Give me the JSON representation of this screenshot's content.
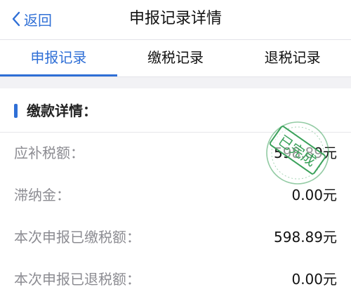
{
  "nav": {
    "back_label": "返回",
    "title": "申报记录详情"
  },
  "tabs": [
    {
      "label": "申报记录",
      "active": true
    },
    {
      "label": "缴税记录",
      "active": false
    },
    {
      "label": "退税记录",
      "active": false
    }
  ],
  "section": {
    "title": "缴款详情："
  },
  "rows": [
    {
      "label": "应补税额：",
      "value": "598.89元"
    },
    {
      "label": "滞纳金：",
      "value": "0.00元"
    },
    {
      "label": "本次申报已缴税额：",
      "value": "598.89元"
    },
    {
      "label": "本次申报已退税额：",
      "value": "0.00元"
    }
  ],
  "stamp": {
    "text": "已完成",
    "color": "#3aa15a"
  },
  "colors": {
    "accent": "#2f6fd6",
    "label": "#8c8c92"
  },
  "icons": {
    "back": "chevron-left-icon"
  }
}
